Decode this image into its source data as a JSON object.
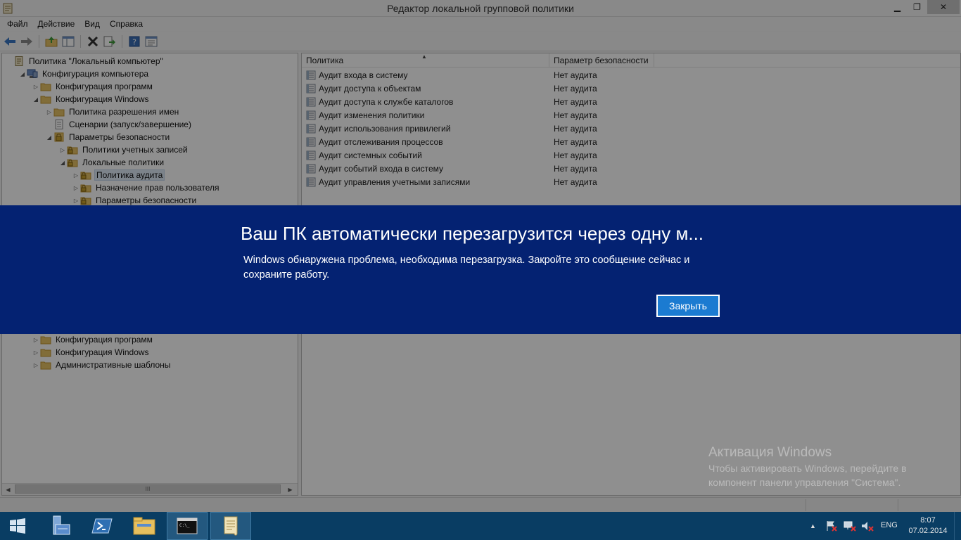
{
  "window": {
    "title": "Редактор локальной групповой политики",
    "controls": {
      "minimize": "▁",
      "maximize": "❐",
      "close": "✕"
    }
  },
  "menu": [
    "Файл",
    "Действие",
    "Вид",
    "Справка"
  ],
  "toolbar": {
    "icons": [
      "back-arrow-icon",
      "forward-arrow-icon",
      "up-folder-icon",
      "show-hide-tree-icon",
      "delete-icon",
      "export-icon",
      "help-icon",
      "properties-icon"
    ]
  },
  "tree": {
    "items": [
      {
        "label": "Политика \"Локальный компьютер\"",
        "level": 0,
        "expander": "",
        "icon": "policy-doc-icon"
      },
      {
        "label": "Конфигурация компьютера",
        "level": 1,
        "expander": "◢",
        "icon": "computer-icon"
      },
      {
        "label": "Конфигурация программ",
        "level": 2,
        "expander": "▷",
        "icon": "folder-icon"
      },
      {
        "label": "Конфигурация Windows",
        "level": 2,
        "expander": "◢",
        "icon": "folder-icon"
      },
      {
        "label": "Политика разрешения имен",
        "level": 3,
        "expander": "▷",
        "icon": "folder-icon"
      },
      {
        "label": "Сценарии (запуск/завершение)",
        "level": 3,
        "expander": "",
        "icon": "script-icon"
      },
      {
        "label": "Параметры безопасности",
        "level": 3,
        "expander": "◢",
        "icon": "security-icon"
      },
      {
        "label": "Политики учетных записей",
        "level": 4,
        "expander": "▷",
        "icon": "lock-folder-icon"
      },
      {
        "label": "Локальные политики",
        "level": 4,
        "expander": "◢",
        "icon": "lock-folder-icon"
      },
      {
        "label": "Политика аудита",
        "level": 5,
        "expander": "▷",
        "icon": "lock-folder-icon",
        "selected": true
      },
      {
        "label": "Назначение прав пользователя",
        "level": 5,
        "expander": "▷",
        "icon": "lock-folder-icon"
      },
      {
        "label": "Параметры безопасности",
        "level": 5,
        "expander": "▷",
        "icon": "lock-folder-icon"
      }
    ],
    "lower_items": [
      {
        "label": "Конфигурация программ",
        "level": 2,
        "expander": "▷",
        "icon": "folder-icon"
      },
      {
        "label": "Конфигурация Windows",
        "level": 2,
        "expander": "▷",
        "icon": "folder-icon"
      },
      {
        "label": "Административные шаблоны",
        "level": 2,
        "expander": "▷",
        "icon": "folder-icon"
      }
    ],
    "scroll_thumb": "III"
  },
  "list": {
    "columns": [
      "Политика",
      "Параметр безопасности"
    ],
    "rows": [
      {
        "policy": "Аудит входа в систему",
        "setting": "Нет аудита"
      },
      {
        "policy": "Аудит доступа к объектам",
        "setting": "Нет аудита"
      },
      {
        "policy": "Аудит доступа к службе каталогов",
        "setting": "Нет аудита"
      },
      {
        "policy": "Аудит изменения политики",
        "setting": "Нет аудита"
      },
      {
        "policy": "Аудит использования привилегий",
        "setting": "Нет аудита"
      },
      {
        "policy": "Аудит отслеживания процессов",
        "setting": "Нет аудита"
      },
      {
        "policy": "Аудит системных событий",
        "setting": "Нет аудита"
      },
      {
        "policy": "Аудит событий входа в систему",
        "setting": "Нет аудита"
      },
      {
        "policy": "Аудит управления учетными записями",
        "setting": "Нет аудита"
      }
    ]
  },
  "restart_banner": {
    "heading": "Ваш ПК автоматически перезагрузится через одну м...",
    "message": "Windows обнаружена проблема, необходима перезагрузка. Закройте это сообщение сейчас и сохраните работу.",
    "button": "Закрыть",
    "color": "#042272"
  },
  "activation": {
    "title": "Активация Windows",
    "text": "Чтобы активировать Windows, перейдите в компонент панели управления \"Система\"."
  },
  "taskbar": {
    "apps": [
      "server-manager-icon",
      "powershell-icon",
      "file-explorer-icon",
      "command-prompt-icon",
      "group-policy-editor-icon"
    ],
    "tray_chevron": "▲",
    "language": "ENG",
    "time": "8:07",
    "date": "07.02.2014"
  }
}
